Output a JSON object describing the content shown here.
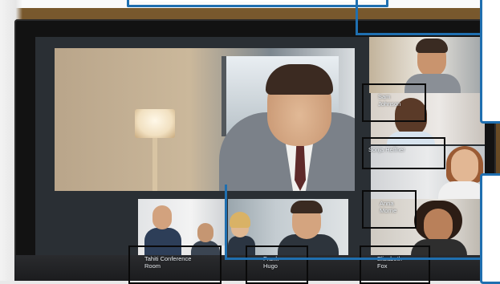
{
  "participants": {
    "sam": {
      "name": "Sam\nJohnson"
    },
    "sonja": {
      "name": "Sonja Heffner"
    },
    "anna": {
      "name": "Anna\nMorrie"
    },
    "tahiti": {
      "name": "Tahiti Conference\nRoom"
    },
    "frank": {
      "name": "Frank\nHugo"
    },
    "elizabeth": {
      "name": "Elizabeth\nFox"
    }
  },
  "colors": {
    "callout_blue": "#1f6fb0",
    "bezel": "#121212",
    "wall": "#6b4d26"
  }
}
